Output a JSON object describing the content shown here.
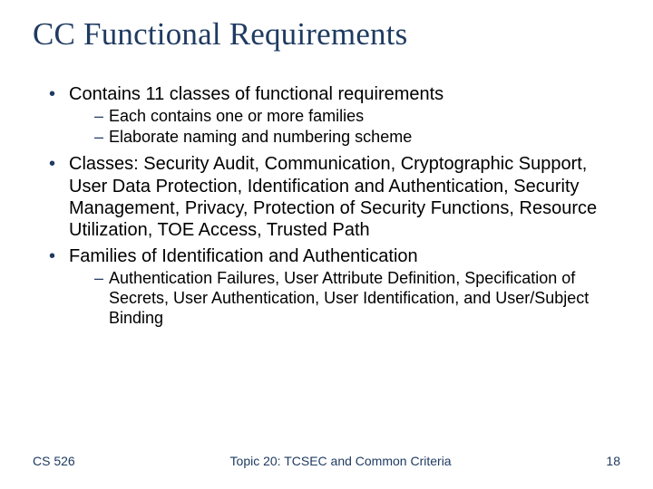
{
  "title": "CC Functional Requirements",
  "bullets": {
    "b1": "Contains 11 classes of functional requirements",
    "b1_sub1": "Each contains one or more families",
    "b1_sub2": "Elaborate naming and numbering scheme",
    "b2": "Classes: Security Audit, Communication, Cryptographic Support, User Data Protection, Identification and Authentication, Security Management, Privacy, Protection of Security Functions, Resource Utilization, TOE Access, Trusted Path",
    "b3": "Families of Identification and Authentication",
    "b3_sub1": "Authentication Failures, User Attribute Definition, Specification of Secrets, User Authentication, User Identification, and User/Subject Binding"
  },
  "footer": {
    "left": "CS 526",
    "center": "Topic 20: TCSEC and Common Criteria",
    "right": "18"
  }
}
